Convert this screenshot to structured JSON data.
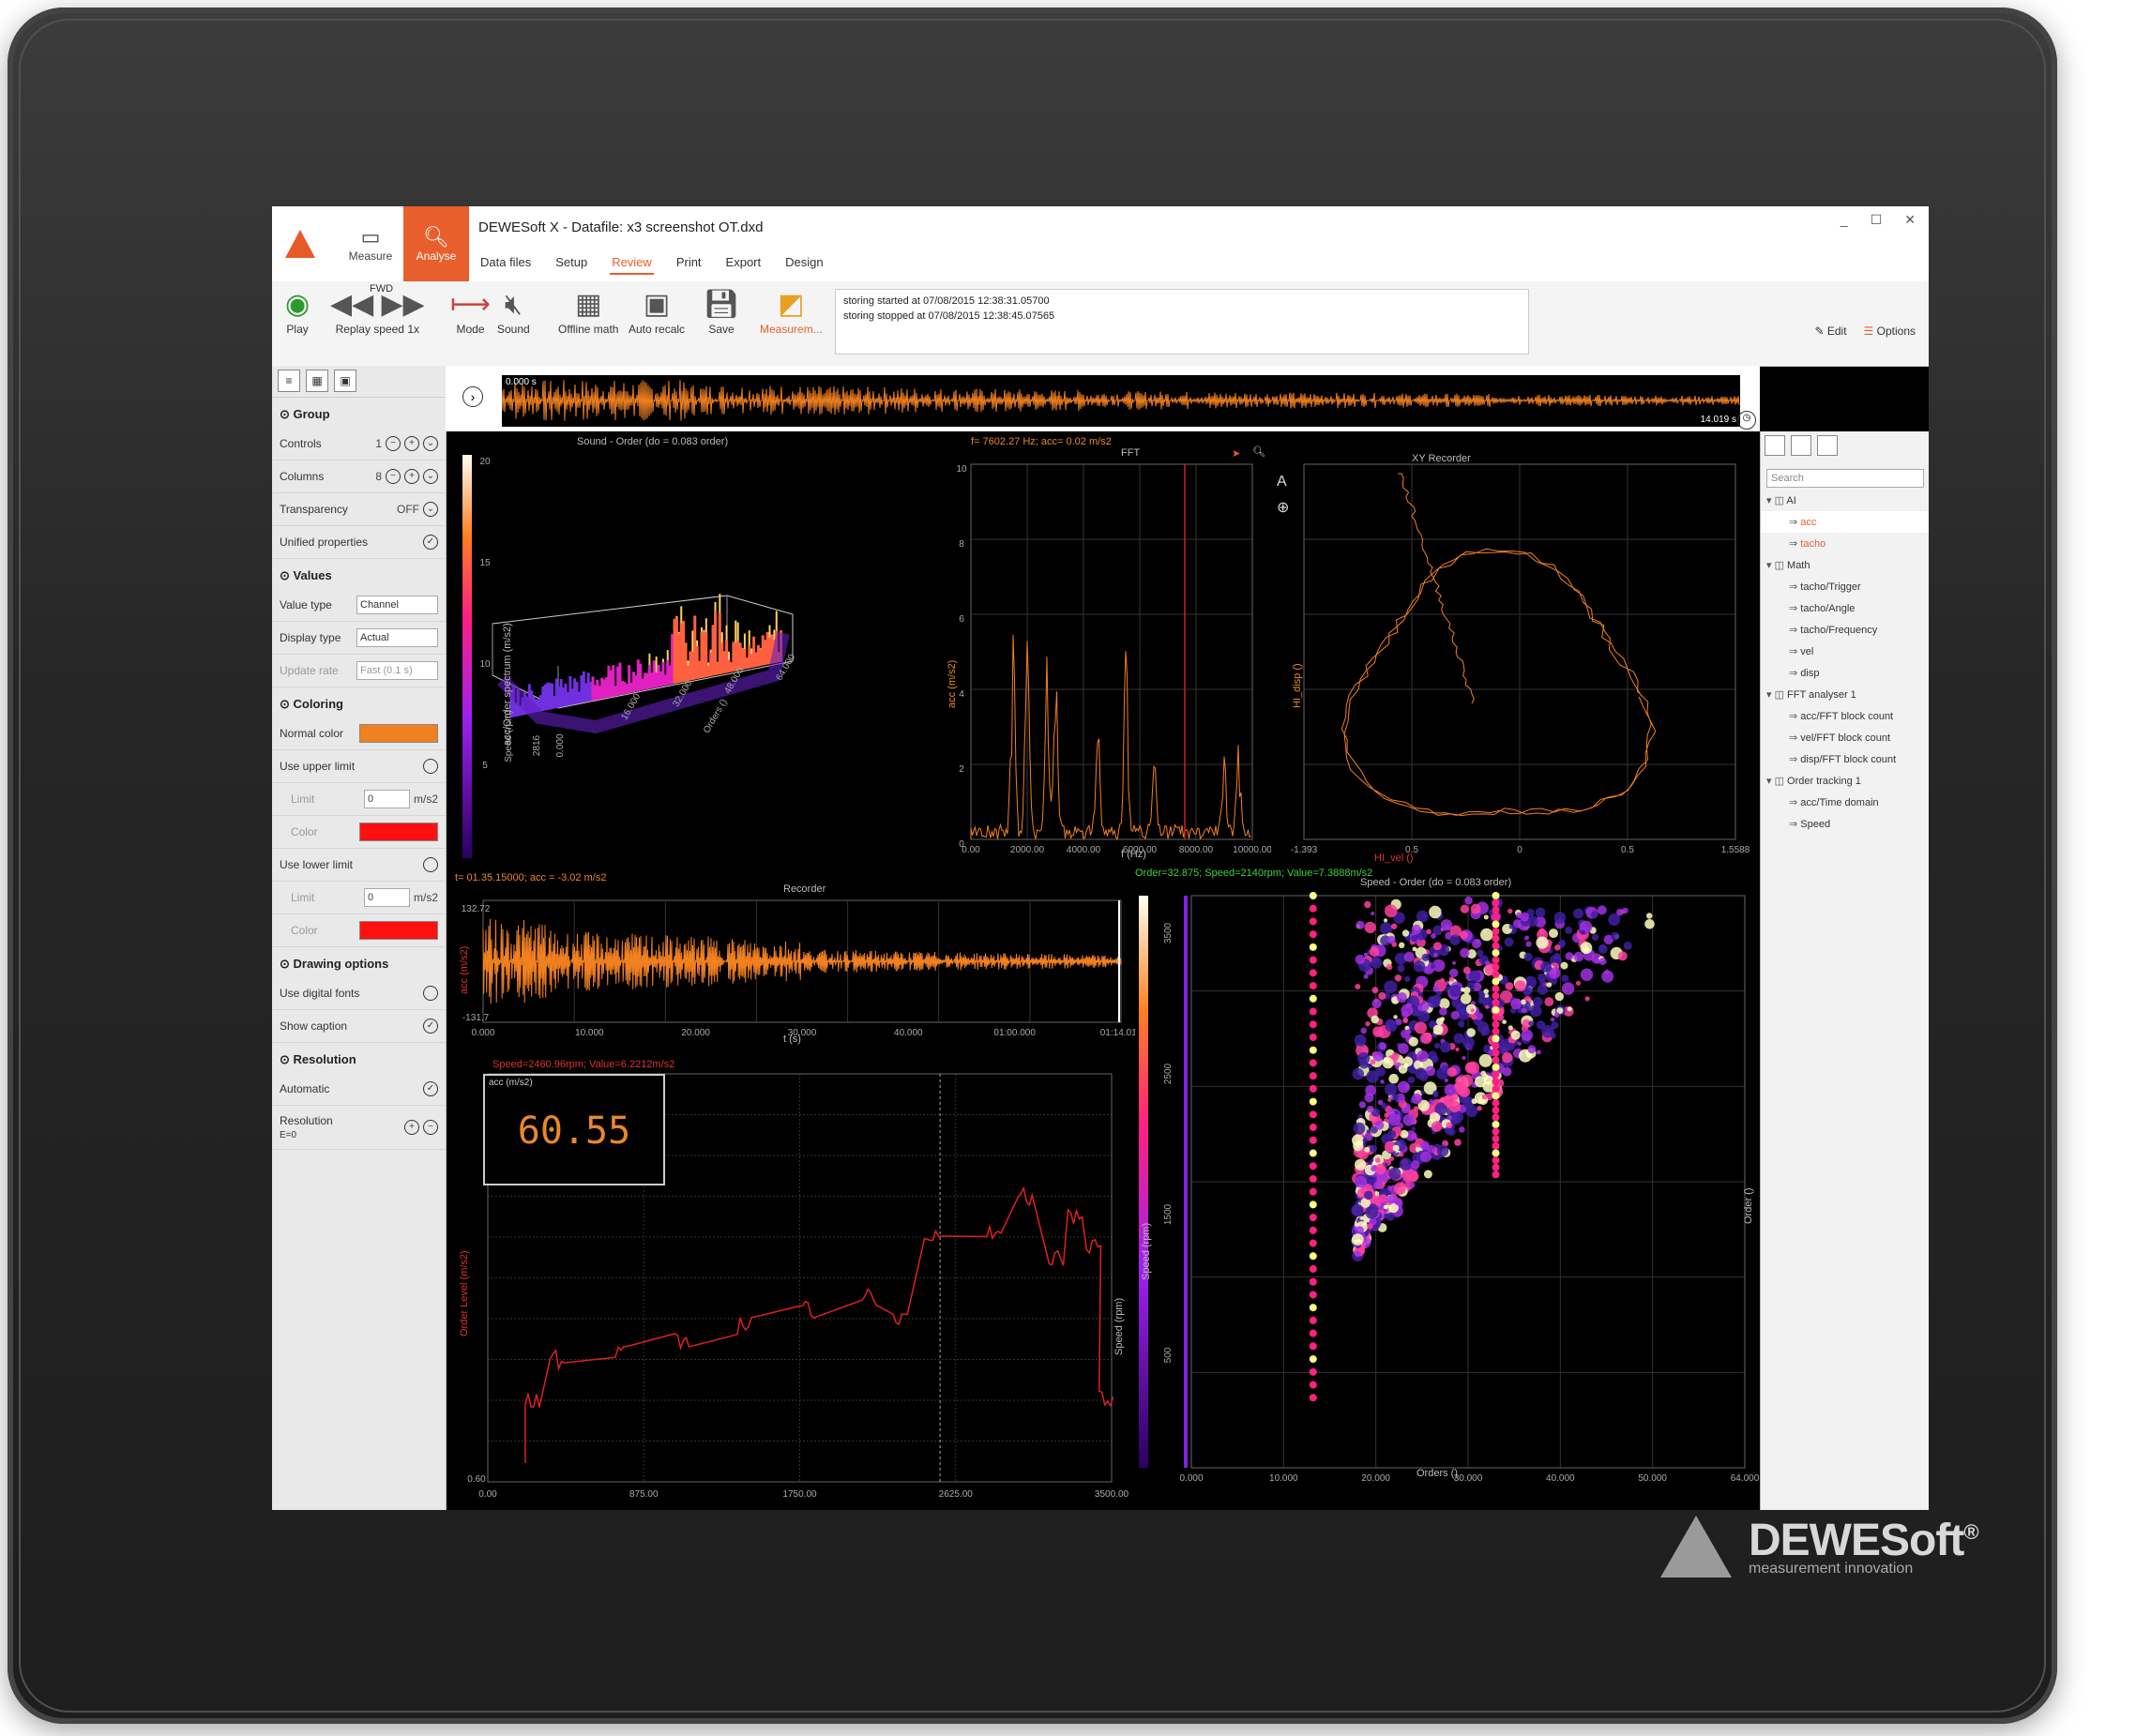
{
  "app": {
    "modes": [
      "Measure",
      "Analyse"
    ],
    "title": "DEWESoft X - Datafile: x3 screenshot OT.dxd",
    "tabs": [
      "Data files",
      "Setup",
      "Review",
      "Print",
      "Export",
      "Design"
    ],
    "active_tab": "Review",
    "window_controls": [
      "_",
      "☐",
      "✕"
    ],
    "edit_label": "Edit",
    "options_label": "Options"
  },
  "ribbon": {
    "play": "Play",
    "fwd": "FWD",
    "replay_speed": "Replay speed",
    "replay_value": "1x",
    "mode": "Mode",
    "sound": "Sound",
    "offline_math": "Offline math",
    "auto_recalc": "Auto recalc",
    "save": "Save",
    "measurement": "Measurem...",
    "log": [
      "storing started at 07/08/2015 12:38:31.05700",
      "storing stopped at 07/08/2015 12:38:45.07565"
    ]
  },
  "left_panel": {
    "group": {
      "title": "Group",
      "controls_label": "Controls",
      "controls_value": "1",
      "columns_label": "Columns",
      "columns_value": "8",
      "transparency_label": "Transparency",
      "transparency_value": "OFF",
      "unified_label": "Unified properties"
    },
    "values": {
      "title": "Values",
      "value_type_label": "Value type",
      "value_type": "Channel",
      "display_type_label": "Display type",
      "display_type": "Actual",
      "update_rate_label": "Update rate",
      "update_rate": "Fast (0.1 s)"
    },
    "coloring": {
      "title": "Coloring",
      "normal_color_label": "Normal color",
      "normal_color": "#f08020",
      "use_upper_label": "Use upper limit",
      "limit_label": "Limit",
      "upper_limit": "0",
      "unit": "m/s2",
      "color_label": "Color",
      "upper_color": "#ff1010",
      "use_lower_label": "Use lower limit",
      "lower_limit": "0",
      "lower_color": "#ff1010"
    },
    "drawing": {
      "title": "Drawing options",
      "digital_fonts_label": "Use digital fonts",
      "show_caption_label": "Show caption"
    },
    "resolution": {
      "title": "Resolution",
      "automatic_label": "Automatic",
      "resolution_label": "Resolution",
      "resolution_value": "E=0"
    }
  },
  "tree": {
    "search": "Search",
    "items": [
      {
        "label": "AI",
        "level": 0,
        "icon": "folder-icon"
      },
      {
        "label": "acc",
        "level": 1,
        "icon": "channel-icon"
      },
      {
        "label": "tacho",
        "level": 1,
        "icon": "channel-icon"
      },
      {
        "label": "Math",
        "level": 0,
        "icon": "group-icon"
      },
      {
        "label": "tacho/Trigger",
        "level": 1,
        "icon": "channel-icon"
      },
      {
        "label": "tacho/Angle",
        "level": 1,
        "icon": "channel-icon"
      },
      {
        "label": "tacho/Frequency",
        "level": 1,
        "icon": "channel-icon"
      },
      {
        "label": "vel",
        "level": 1,
        "icon": "channel-icon"
      },
      {
        "label": "disp",
        "level": 1,
        "icon": "channel-icon"
      },
      {
        "label": "FFT analyser 1",
        "level": 0,
        "icon": "group-icon"
      },
      {
        "label": "acc/FFT block count",
        "level": 1,
        "icon": "channel-icon"
      },
      {
        "label": "vel/FFT block count",
        "level": 1,
        "icon": "channel-icon"
      },
      {
        "label": "disp/FFT block count",
        "level": 1,
        "icon": "channel-icon"
      },
      {
        "label": "Order tracking 1",
        "level": 0,
        "icon": "group-icon"
      },
      {
        "label": "acc/Time domain",
        "level": 1,
        "icon": "channel-icon"
      },
      {
        "label": "Speed",
        "level": 1,
        "icon": "channel-icon"
      }
    ]
  },
  "overview": {
    "left_time": "0.000 s",
    "right_time": "14.019 s"
  },
  "plots": {
    "order3d": {
      "caption": "Sound - Order (do = 0.083 order)",
      "colorbar_ticks": [
        "20",
        "15",
        "10",
        "5"
      ],
      "z_axis": "acc/Order spectrum (m/s2)",
      "speed_axis": "Speed (rpm)",
      "orders_axis": "Orders ()",
      "speed_ticks": [
        "2816",
        "0.000"
      ],
      "order_ticks": [
        "16.000",
        "32.000",
        "48.000",
        "64.000"
      ]
    },
    "fft": {
      "caption_left": "f= 7602.27 Hz; acc= 0.02 m/s2",
      "title": "FFT",
      "y_axis": "acc (m/s2)",
      "x_axis": "f (Hz)",
      "y_ticks": [
        "10",
        "8",
        "6",
        "4",
        "2",
        "0"
      ],
      "x_ticks": [
        "0.00",
        "2000.00",
        "4000.00",
        "6000.00",
        "8000.00",
        "10000.00"
      ]
    },
    "xy": {
      "title": "XY Recorder",
      "x_axis": "HI_vel ()",
      "y_axis": "HI_disp ()",
      "x_ticks": [
        "-1.393",
        "0.5",
        "0",
        "0.5",
        "1.5588"
      ]
    },
    "recorder": {
      "caption": "t= 01.35.15000; acc = -3.02 m/s2",
      "title": "Recorder",
      "y_axis": "acc (m/s2)",
      "y_ticks": [
        "132.72",
        "-131.7"
      ],
      "x_axis": "t (s)",
      "x_ticks": [
        "0.000",
        "10.000",
        "20.000",
        "30.000",
        "40.000",
        "01:00.000",
        "01:14.019"
      ]
    },
    "order_line": {
      "caption": "Speed=2460.96rpm; Value=6.2212m/s2",
      "digital_label": "acc (m/s2)",
      "digital_value": "60.55",
      "y_axis": "Order Level (m/s2)",
      "right_axis": "Speed (rpm)",
      "y_ticks": [
        "0.60"
      ],
      "x_ticks": [
        "0.00",
        "875.00",
        "1750.00",
        "2625.00",
        "3500.00"
      ]
    },
    "campbell": {
      "caption": "Order=32.875; Speed=2140rpm; Value=7.3888m/s2",
      "title": "Speed - Order (do = 0.083 order)",
      "y_axis": "Speed (rpm)",
      "x_axis": "Orders ()",
      "right_axis": "Order ()",
      "x_ticks": [
        "0.000",
        "10.000",
        "20.000",
        "30.000",
        "40.000",
        "50.000",
        "64.000"
      ],
      "y_ticks": [
        "3500",
        "2500",
        "1500",
        "500"
      ]
    }
  },
  "device": {
    "brand": "DEWESoft",
    "tagline": "measurement innovation",
    "registered": "®"
  }
}
